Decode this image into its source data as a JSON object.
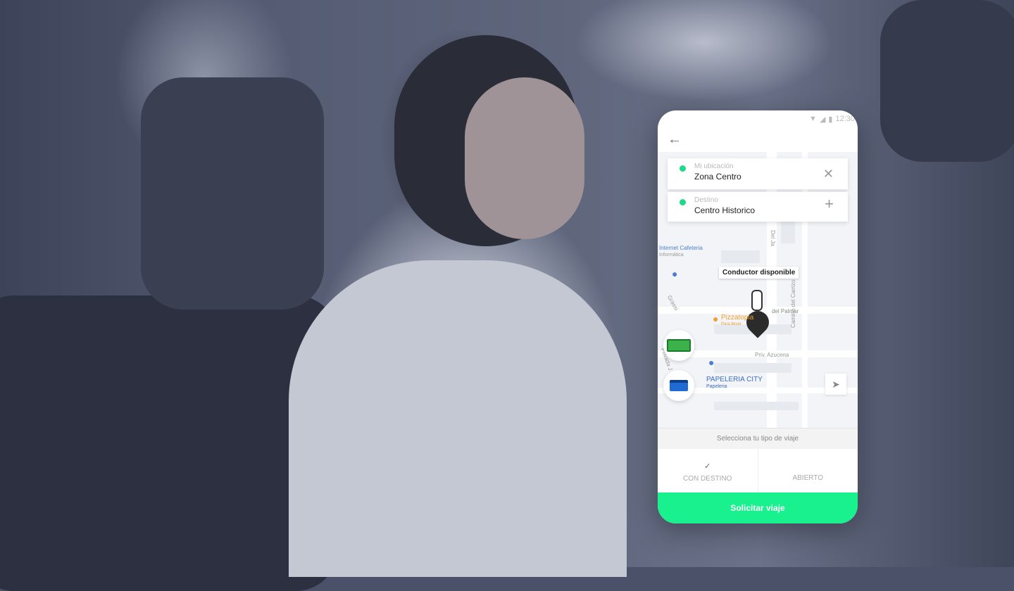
{
  "status_bar": {
    "time": "12:30"
  },
  "trip": {
    "origin": {
      "label": "Mi ubicación",
      "value": "Zona Centro"
    },
    "destination": {
      "label": "Destino",
      "value": "Centro Historico"
    }
  },
  "map": {
    "driver_tooltip": "Conductor disponible",
    "labels": {
      "cafe": "Internet Cafeteria",
      "cafe_sub": "Informática",
      "pizza": "Pizzatopia",
      "pizza_sub": "Para llevar",
      "palmar": "del Palmar",
      "azucena": "Priv. Azucena",
      "carrizo": "Camino del Carrizo",
      "papeleria": "PAPELERIA CITY",
      "papeleria_sub": "Papeleria",
      "street_a": "Del Ja",
      "street_b": "Grassi",
      "street_c": "Privada J"
    }
  },
  "trip_type": {
    "prompt": "Selecciona tu tipo de viaje",
    "options": [
      {
        "label": "CON DESTINO",
        "selected": true
      },
      {
        "label": "ABIERTO",
        "selected": false
      }
    ],
    "check": "✓"
  },
  "cta": "Solicitar viaje",
  "colors": {
    "accent": "#19f08e",
    "pin": "#1ed98a"
  }
}
